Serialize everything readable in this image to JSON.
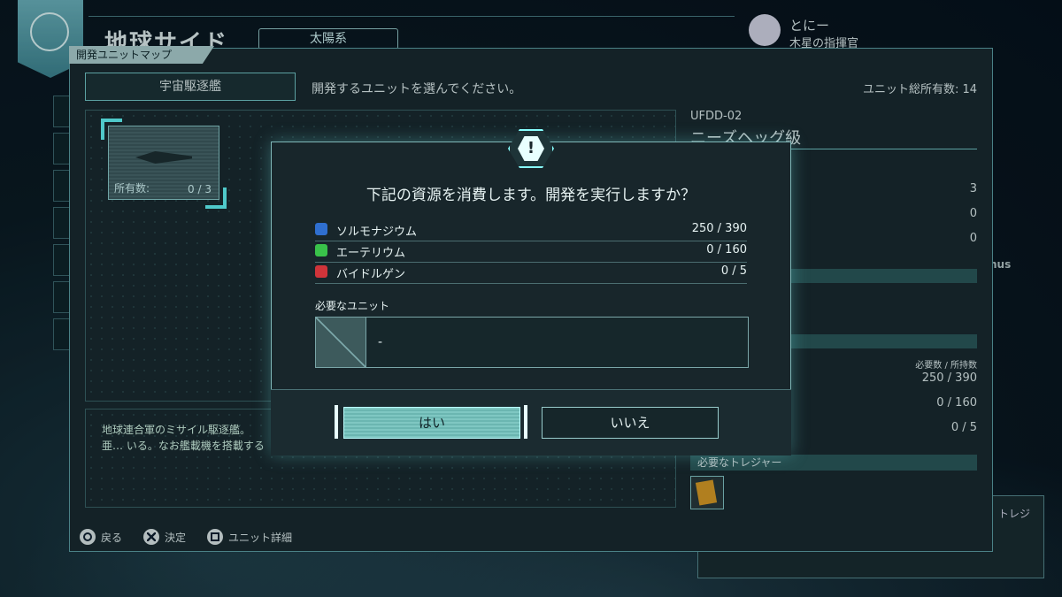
{
  "header": {
    "title": "地球サイド",
    "sub": "太陽系"
  },
  "user": {
    "name": "とにー",
    "role": "木星の指揮官"
  },
  "panel": {
    "tab": "開発ユニットマップ",
    "category": "宇宙駆逐艦",
    "instruction": "開発するユニットを選んでください。",
    "total_label": "ユニット総所有数: 14"
  },
  "unit_card": {
    "own_label": "所有数:",
    "own_value": "0 / 3"
  },
  "description": "地球連合軍のミサイル駆逐艦。亜… いる。なお艦載機を搭載する機能…",
  "detail": {
    "code": "UFDD-02",
    "class_name": "ニーズヘッグ級",
    "stats": [
      "3",
      "0",
      "0"
    ],
    "req_head": "必要数 / 所持数",
    "req_values": [
      "250 / 390",
      "0 / 160",
      "0 / 5"
    ],
    "treasure_label": "必要なトレジャー"
  },
  "ghost_text": "トレジ",
  "venus": "nus",
  "controls": [
    {
      "label": "戻る"
    },
    {
      "label": "決定"
    },
    {
      "label": "ユニット詳細"
    }
  ],
  "dialog": {
    "title": "下記の資源を消費します。開発を実行しますか？",
    "resources": [
      {
        "name": "ソルモナジウム",
        "value": "250 / 390",
        "color": "#2f6fd0",
        "icon": "solmonagium-icon"
      },
      {
        "name": "エーテリウム",
        "value": "0 / 160",
        "color": "#39c24a",
        "icon": "aetherium-icon"
      },
      {
        "name": "バイドルゲン",
        "value": "0 / 5",
        "color": "#d0343a",
        "icon": "bydorgen-icon"
      }
    ],
    "required_label": "必要なユニット",
    "required_value": "-",
    "yes": "はい",
    "no": "いいえ"
  }
}
